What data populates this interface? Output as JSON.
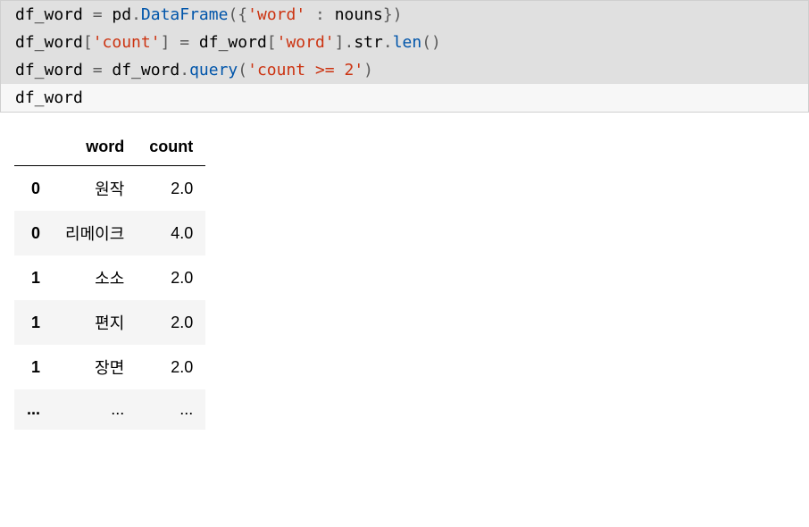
{
  "code": {
    "line1": {
      "var": "df_word",
      "eq": " = ",
      "obj": "pd",
      "dot1": ".",
      "call": "DataFrame",
      "paren_open": "({",
      "str1": "'word'",
      "colon": " : ",
      "arg": "nouns",
      "paren_close": "})"
    },
    "line2": {
      "var": "df_word",
      "br_open": "[",
      "str1": "'count'",
      "br_close": "]",
      "eq": " = ",
      "var2": "df_word",
      "br_open2": "[",
      "str2": "'word'",
      "br_close2": "]",
      "dot1": ".",
      "attr1": "str",
      "dot2": ".",
      "call": "len",
      "parens": "()"
    },
    "line3": {
      "var": "df_word",
      "eq": " = ",
      "var2": "df_word",
      "dot1": ".",
      "call": "query",
      "paren_open": "(",
      "str1": "'count >= 2'",
      "paren_close": ")"
    },
    "line4": {
      "var": "df_word"
    }
  },
  "table": {
    "columns": [
      "",
      "word",
      "count"
    ],
    "rows": [
      {
        "idx": "0",
        "word": "원작",
        "count": "2.0"
      },
      {
        "idx": "0",
        "word": "리메이크",
        "count": "4.0"
      },
      {
        "idx": "1",
        "word": "소소",
        "count": "2.0"
      },
      {
        "idx": "1",
        "word": "편지",
        "count": "2.0"
      },
      {
        "idx": "1",
        "word": "장면",
        "count": "2.0"
      },
      {
        "idx": "...",
        "word": "...",
        "count": "..."
      }
    ]
  }
}
